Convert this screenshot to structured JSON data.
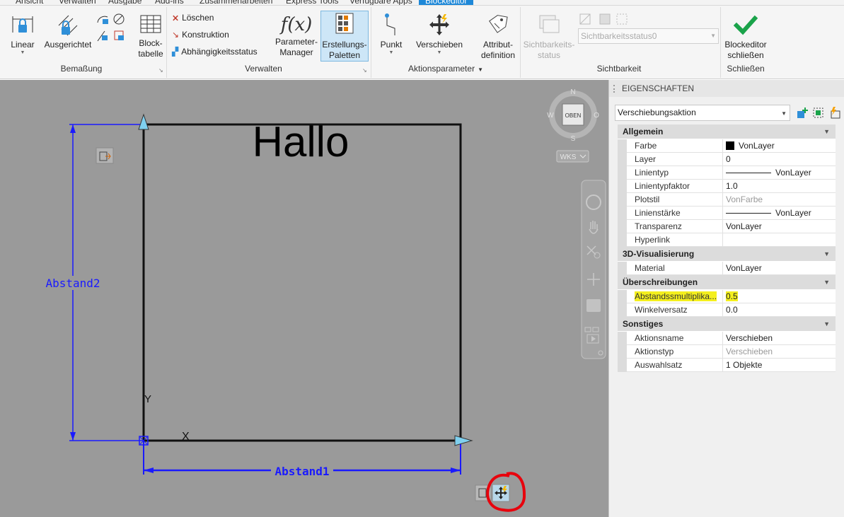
{
  "tabs": [
    "Ansicht",
    "Verwalten",
    "Ausgabe",
    "Add-ins",
    "Zusammenarbeiten",
    "Express Tools",
    "Verfügbare Apps",
    "Blockeditor"
  ],
  "ribbon": {
    "bemassung": {
      "group": "Bemaßung",
      "linear": "Linear",
      "ausgerichtet": "Ausgerichtet"
    },
    "verwalten": {
      "group": "Verwalten",
      "blocktabelle": [
        "Block-",
        "tabelle"
      ],
      "loeschen": "Löschen",
      "konstruktion": "Konstruktion",
      "abhaengigkeit": "Abhängigkeitsstatus",
      "parameter_manager": [
        "Parameter-",
        "Manager"
      ],
      "erstellungs_paletten": [
        "Erstellungs-",
        "Paletten"
      ]
    },
    "aktionsparameter": {
      "group": "Aktionsparameter",
      "punkt": "Punkt",
      "verschieben": "Verschieben",
      "attribut": [
        "Attribut-",
        "definition"
      ]
    },
    "sichtbarkeit": {
      "group": "Sichtbarkeit",
      "status_btn": [
        "Sichtbarkeits-",
        "status"
      ],
      "select_value": "Sichtbarkeitsstatus0"
    },
    "schliessen": {
      "group": "Schließen",
      "close_btn": [
        "Blockeditor",
        "schließen"
      ]
    }
  },
  "canvas": {
    "text": "Hallo",
    "dim_horizontal": "Abstand1",
    "dim_vertical": "Abstand2",
    "axis_y": "Y",
    "axis_x": "X",
    "viewcube": {
      "top": "OBEN",
      "n": "N",
      "s": "S",
      "w": "W",
      "e": "O",
      "ucs": "WKS"
    }
  },
  "properties": {
    "title": "EIGENSCHAFTEN",
    "selected": "Verschiebungsaktion",
    "categories": [
      {
        "name": "Allgemein",
        "rows": [
          {
            "name": "Farbe",
            "value": "VonLayer",
            "kind": "swatch"
          },
          {
            "name": "Layer",
            "value": "0"
          },
          {
            "name": "Linientyp",
            "value": "VonLayer",
            "kind": "line"
          },
          {
            "name": "Linientypfaktor",
            "value": "1.0"
          },
          {
            "name": "Plotstil",
            "value": "VonFarbe",
            "kind": "grey"
          },
          {
            "name": "Linienstärke",
            "value": "VonLayer",
            "kind": "line"
          },
          {
            "name": "Transparenz",
            "value": "VonLayer"
          },
          {
            "name": "Hyperlink",
            "value": ""
          }
        ]
      },
      {
        "name": "3D-Visualisierung",
        "rows": [
          {
            "name": "Material",
            "value": "VonLayer"
          }
        ]
      },
      {
        "name": "Überschreibungen",
        "rows": [
          {
            "name": "Abstandssmultiplika...",
            "value": "0.5",
            "kind": "highlight"
          },
          {
            "name": "Winkelversatz",
            "value": "0.0"
          }
        ]
      },
      {
        "name": "Sonstiges",
        "rows": [
          {
            "name": "Aktionsname",
            "value": "Verschieben"
          },
          {
            "name": "Aktionstyp",
            "value": "Verschieben",
            "kind": "grey"
          },
          {
            "name": "Auswahlsatz",
            "value": "1 Objekte"
          }
        ]
      }
    ]
  },
  "colors": {
    "canvas": "#9a9a9a",
    "dimension": "#1a1aff",
    "highlight": "#f4ef1e",
    "annotation": "#e8000c",
    "accent": "#1e88d8"
  }
}
